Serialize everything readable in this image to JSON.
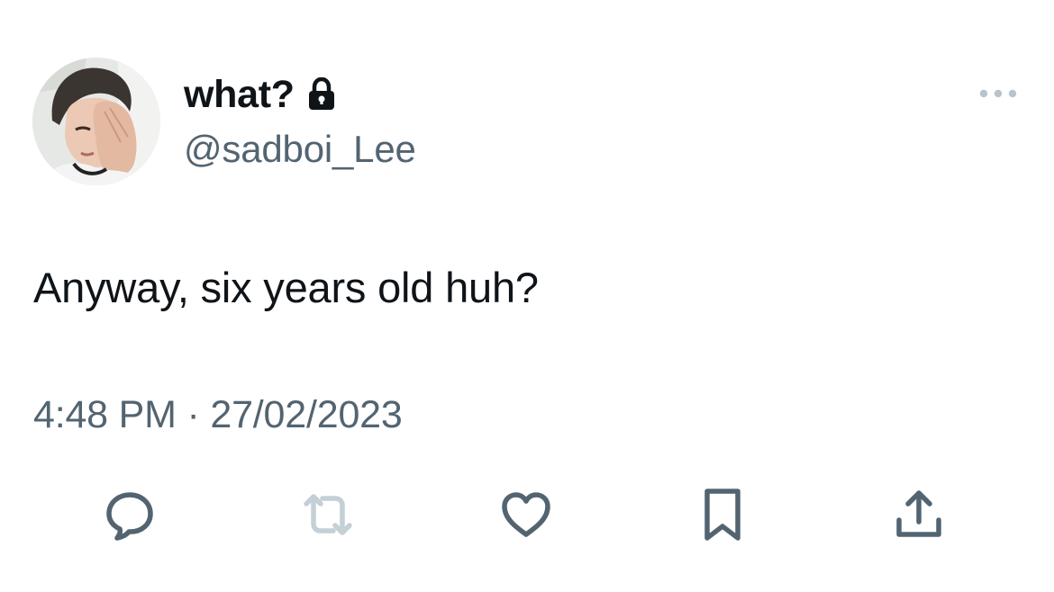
{
  "author": {
    "display_name": "what?",
    "handle": "@sadboi_Lee",
    "avatar_icon": "avatar-photo",
    "protected_icon": "lock-icon"
  },
  "tweet": {
    "text": "Anyway, six years old huh?",
    "time": "4:48 PM",
    "separator": "·",
    "date": "27/02/2023"
  },
  "actions": [
    {
      "name": "reply",
      "icon": "reply-icon",
      "enabled": true
    },
    {
      "name": "retweet",
      "icon": "retweet-icon",
      "enabled": false
    },
    {
      "name": "like",
      "icon": "heart-icon",
      "enabled": true
    },
    {
      "name": "bookmark",
      "icon": "bookmark-icon",
      "enabled": true
    },
    {
      "name": "share",
      "icon": "share-icon",
      "enabled": true
    }
  ],
  "colors": {
    "text_primary": "#0f1419",
    "text_secondary": "#536471",
    "icon_disabled": "#c4cfd6",
    "background": "#ffffff"
  }
}
